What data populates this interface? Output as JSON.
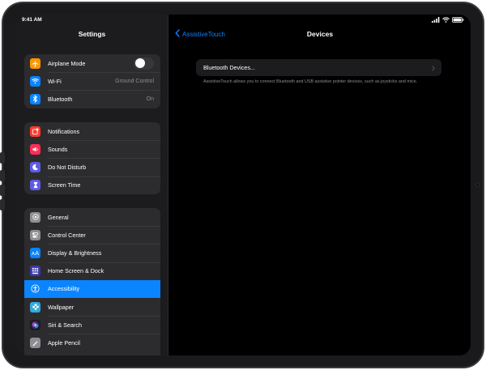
{
  "status_bar": {
    "time": "9:41 AM",
    "icons": [
      "cellular-icon",
      "wifi-icon",
      "battery-icon"
    ]
  },
  "sidebar": {
    "title": "Settings",
    "groups": [
      {
        "items": [
          {
            "label": "Airplane Mode",
            "icon": "airplane-icon",
            "color": "#ff9500",
            "control": "toggle",
            "toggle_on": false
          },
          {
            "label": "Wi-Fi",
            "icon": "wifi-icon",
            "color": "#0a84ff",
            "value": "Ground Control"
          },
          {
            "label": "Bluetooth",
            "icon": "bluetooth-icon",
            "color": "#0a84ff",
            "value": "On"
          }
        ]
      },
      {
        "items": [
          {
            "label": "Notifications",
            "icon": "notifications-icon",
            "color": "#ff3b30"
          },
          {
            "label": "Sounds",
            "icon": "speaker-icon",
            "color": "#ff2d55"
          },
          {
            "label": "Do Not Disturb",
            "icon": "moon-icon",
            "color": "#5e5ce6"
          },
          {
            "label": "Screen Time",
            "icon": "hourglass-icon",
            "color": "#5e5ce6"
          }
        ]
      },
      {
        "items": [
          {
            "label": "General",
            "icon": "gear-icon",
            "color": "#8e8e93"
          },
          {
            "label": "Control Center",
            "icon": "switches-icon",
            "color": "#8e8e93"
          },
          {
            "label": "Display & Brightness",
            "icon": "text-size-icon",
            "color": "#0a84ff"
          },
          {
            "label": "Home Screen & Dock",
            "icon": "grid-icon",
            "color": "#3a3aa8"
          },
          {
            "label": "Accessibility",
            "icon": "accessibility-icon",
            "color": "#0a84ff",
            "selected": true
          },
          {
            "label": "Wallpaper",
            "icon": "flower-icon",
            "color": "#34aadc"
          },
          {
            "label": "Siri & Search",
            "icon": "siri-icon",
            "color": "#1c1c1e"
          },
          {
            "label": "Apple Pencil",
            "icon": "pencil-icon",
            "color": "#8e8e93"
          }
        ]
      }
    ]
  },
  "detail": {
    "back_label": "AssistiveTouch",
    "title": "Devices",
    "row_label": "Bluetooth Devices...",
    "footnote": "AssistiveTouch allows you to connect Bluetooth and USB assistive pointer devices, such as joysticks and mice."
  },
  "colors": {
    "accent": "#0a84ff",
    "background": "#000000",
    "sidebar_background": "#1c1c1e",
    "cell_background": "#2c2c2e"
  }
}
